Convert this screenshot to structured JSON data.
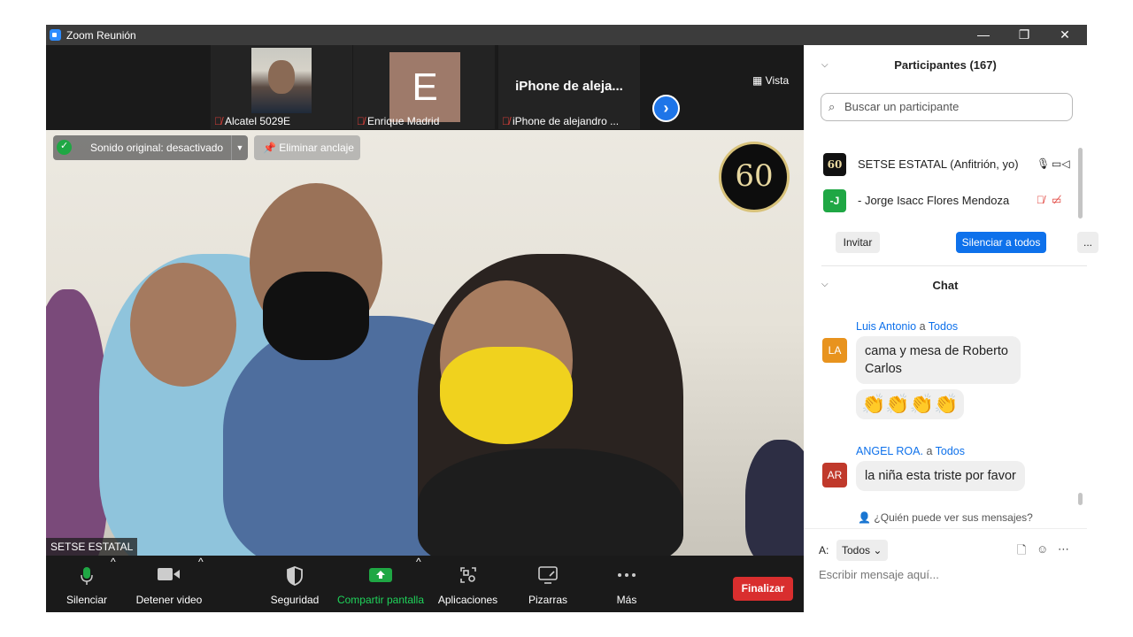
{
  "window": {
    "title": "Zoom Reunión",
    "controls": [
      "—",
      "❐",
      "✕"
    ]
  },
  "thumbnails": [
    {
      "name": "Alcatel 5029E"
    },
    {
      "name": "Enrique Madrid",
      "initial": "E"
    },
    {
      "name": "iPhone de alejandro ...",
      "big_name": "iPhone de aleja..."
    }
  ],
  "view_button": "Vista",
  "main_video": {
    "sound_status": "Sonido original: desactivado",
    "unpin": "Eliminar anclaje",
    "speaker_name": "SETSE ESTATAL",
    "logo_text": "60"
  },
  "toolbar": {
    "mute": "Silenciar",
    "stop_video": "Detener video",
    "security": "Seguridad",
    "share": "Compartir pantalla",
    "apps": "Aplicaciones",
    "whiteboards": "Pizarras",
    "more": "Más",
    "end": "Finalizar"
  },
  "participants": {
    "header": "Participantes (167)",
    "search_placeholder": "Buscar un participante",
    "list": [
      {
        "name": "SETSE ESTATAL (Anfitrión, yo)",
        "avatar": "60"
      },
      {
        "name": "- Jorge Isacc Flores Mendoza",
        "avatar": "-J"
      }
    ],
    "invite": "Invitar",
    "mute_all": "Silenciar a todos",
    "more": "..."
  },
  "chat": {
    "header": "Chat",
    "messages": [
      {
        "from": "Luis Antonio",
        "sep": "a",
        "to": "Todos",
        "initials": "LA",
        "text": "cama y mesa de Roberto Carlos",
        "emoji": "👏👏👏👏"
      },
      {
        "from": "ANGEL ROA.",
        "sep": "a",
        "to": "Todos",
        "initials": "AR",
        "text": "la niña esta triste por favor"
      }
    ],
    "who_can_see": "¿Quién puede ver sus mensajes?",
    "to_label": "A:",
    "to_value": "Todos",
    "input_placeholder": "Escribir mensaje aquí..."
  },
  "colors": {
    "accent": "#0e71eb",
    "end": "#d92e2e",
    "share": "#1fa744",
    "la_avatar": "#e8931e",
    "ar_avatar": "#c0392b"
  }
}
